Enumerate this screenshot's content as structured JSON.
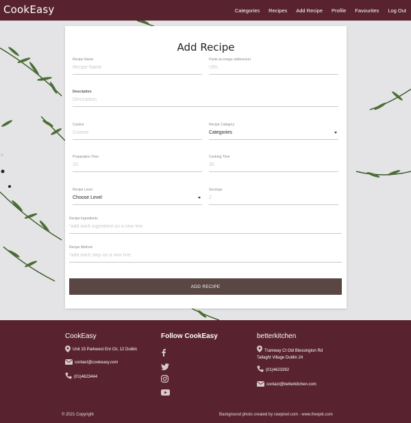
{
  "brand": "CookEasy",
  "nav": [
    "Categories",
    "Recipes",
    "Add Recipe",
    "Profile",
    "Favourites",
    "Log Out"
  ],
  "form": {
    "title": "Add Recipe",
    "recipe_name": {
      "label": "Recipe Name",
      "placeholder": "Recipe Name"
    },
    "image_url": {
      "label": "Paste an image address/url",
      "placeholder": "URL"
    },
    "description": {
      "label": "Description",
      "placeholder": "Description"
    },
    "cuisine": {
      "label": "Cuisine",
      "placeholder": "Cuisine"
    },
    "category": {
      "label": "Recipe Category",
      "value": "Categories"
    },
    "prep_time": {
      "label": "Preparation Time",
      "placeholder": "20"
    },
    "cook_time": {
      "label": "Cooking Time",
      "placeholder": "30"
    },
    "level": {
      "label": "Recipe Level",
      "value": "Choose Level"
    },
    "servings": {
      "label": "Servings",
      "placeholder": "2"
    },
    "ingredients": {
      "label": "Recipe Ingredients",
      "placeholder": "*add each ingredient on a new line"
    },
    "method": {
      "label": "Recipe Method",
      "placeholder": "*add each step on a new line"
    },
    "submit_label": "ADD RECIPE"
  },
  "footer": {
    "col1": {
      "title": "CookEasy",
      "address": "Unit 15 Parkwest Ent Ctr, 12 Dublin",
      "email": "contact@cookeasy.com",
      "phone": "(01)4623444"
    },
    "col2": {
      "title": "Follow CookEasy",
      "icons": [
        "facebook-icon",
        "twitter-icon",
        "instagram-icon",
        "youtube-icon"
      ]
    },
    "col3": {
      "title": "betterkitchen",
      "address_line1": "Tramway Ct Old Blessington Rd",
      "address_line2": "Tallaght Village Dublin 24",
      "phone": "(01)4623392",
      "email": "contact@betterkitchen.com"
    },
    "copyright": "© 2021 Copyright",
    "credit": "Background photo created by rawpixel.com - www.freepik.com"
  },
  "colors": {
    "brand": "#58232e",
    "button": "#5a4744"
  }
}
